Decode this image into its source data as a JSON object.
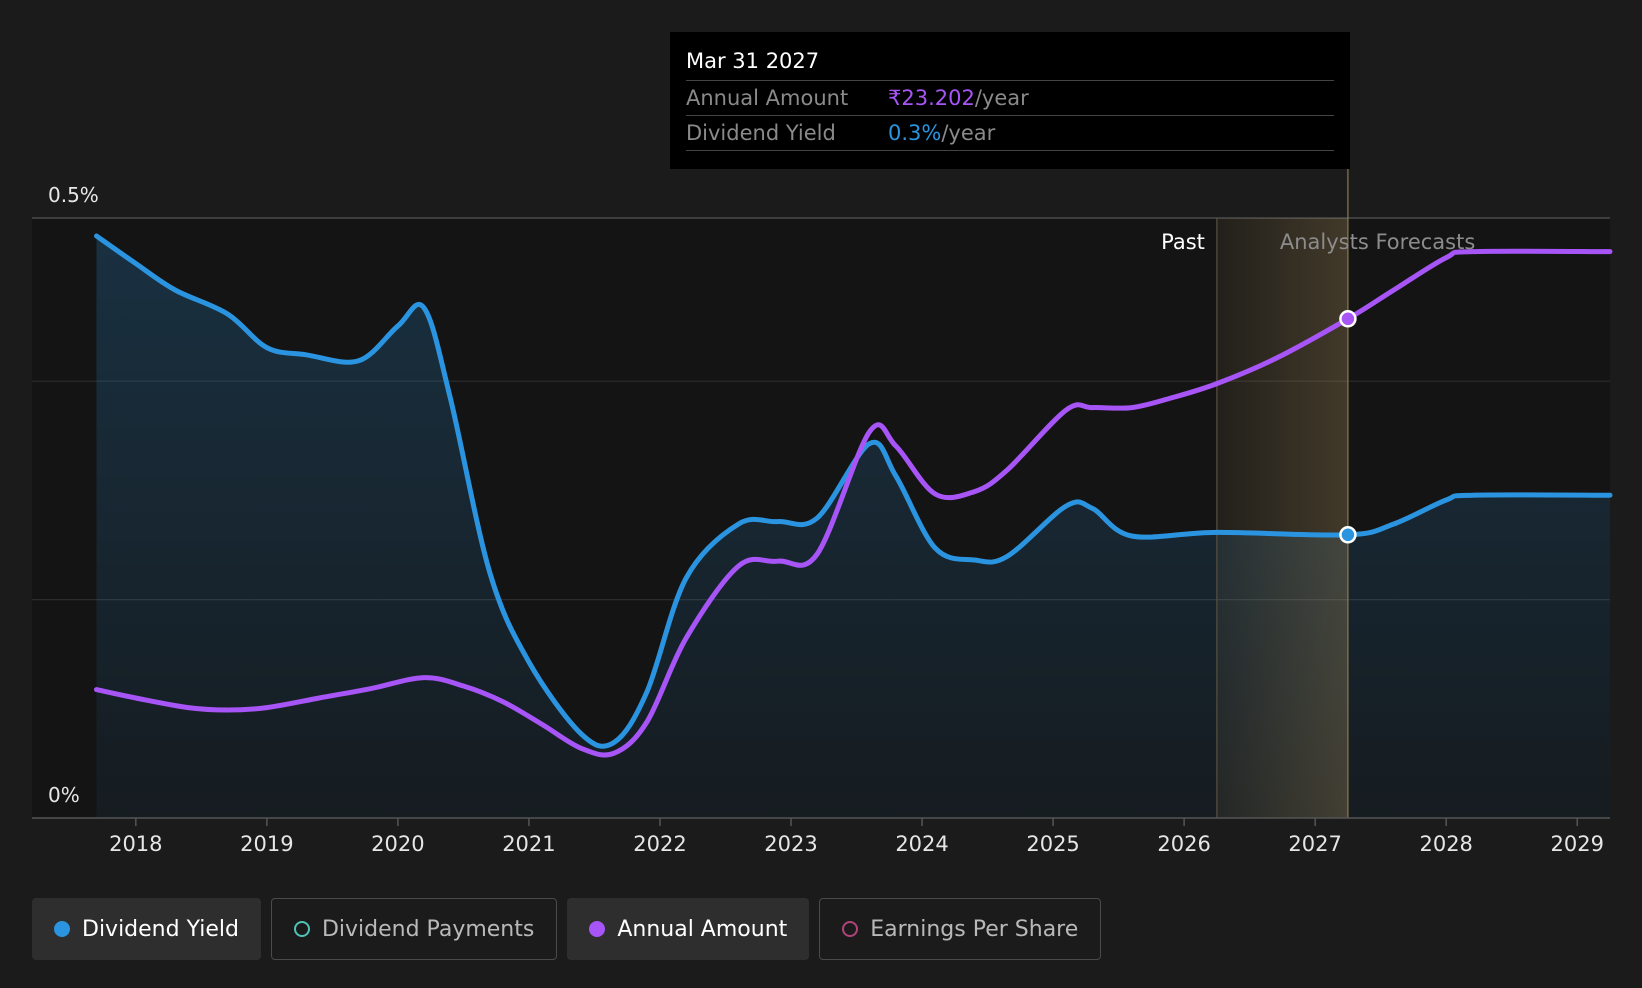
{
  "tooltip": {
    "date": "Mar 31 2027",
    "rows": [
      {
        "label": "Annual Amount",
        "value": "₹23.202",
        "unit": "/year"
      },
      {
        "label": "Dividend Yield",
        "value": "0.3%",
        "unit": "/year"
      }
    ]
  },
  "legend": [
    {
      "label": "Dividend Yield",
      "color": "#2b94e0",
      "active": true
    },
    {
      "label": "Dividend Payments",
      "color": "#4fc3b5",
      "active": false
    },
    {
      "label": "Annual Amount",
      "color": "#a855f7",
      "active": true
    },
    {
      "label": "Earnings Per Share",
      "color": "#b0437a",
      "active": false
    }
  ],
  "chart_data": {
    "type": "line",
    "y_tick_labels": [
      "0.5%",
      "0%"
    ],
    "ylim": [
      0,
      0.5
    ],
    "xlim": [
      2017.7,
      2029.25
    ],
    "x_ticks": [
      2018,
      2019,
      2020,
      2021,
      2022,
      2023,
      2024,
      2025,
      2026,
      2027,
      2028,
      2029
    ],
    "regions": {
      "past_label": "Past",
      "forecast_label": "Analysts Forecasts",
      "past_end": 2026.25,
      "forecast_band_end": 2027.25
    },
    "hover_x": 2027.25,
    "series": [
      {
        "name": "Dividend Yield",
        "color": "#2b94e0",
        "area": true,
        "points": [
          [
            2017.7,
            0.485
          ],
          [
            2018.0,
            0.462
          ],
          [
            2018.3,
            0.44
          ],
          [
            2018.7,
            0.42
          ],
          [
            2019.0,
            0.392
          ],
          [
            2019.3,
            0.386
          ],
          [
            2019.7,
            0.381
          ],
          [
            2020.0,
            0.41
          ],
          [
            2020.2,
            0.425
          ],
          [
            2020.4,
            0.35
          ],
          [
            2020.7,
            0.205
          ],
          [
            2021.0,
            0.13
          ],
          [
            2021.4,
            0.07
          ],
          [
            2021.65,
            0.063
          ],
          [
            2021.9,
            0.105
          ],
          [
            2022.2,
            0.2
          ],
          [
            2022.6,
            0.245
          ],
          [
            2022.9,
            0.247
          ],
          [
            2023.2,
            0.25
          ],
          [
            2023.6,
            0.312
          ],
          [
            2023.8,
            0.285
          ],
          [
            2024.1,
            0.225
          ],
          [
            2024.4,
            0.215
          ],
          [
            2024.65,
            0.218
          ],
          [
            2025.1,
            0.26
          ],
          [
            2025.3,
            0.258
          ],
          [
            2025.6,
            0.235
          ],
          [
            2026.25,
            0.238
          ],
          [
            2027.25,
            0.236
          ],
          [
            2027.6,
            0.245
          ],
          [
            2028.0,
            0.265
          ],
          [
            2028.2,
            0.269
          ],
          [
            2029.25,
            0.269
          ]
        ]
      },
      {
        "name": "Annual Amount",
        "color": "#a855f7",
        "area": false,
        "points": [
          [
            2017.7,
            0.107
          ],
          [
            2018.0,
            0.1
          ],
          [
            2018.4,
            0.092
          ],
          [
            2018.7,
            0.09
          ],
          [
            2019.0,
            0.092
          ],
          [
            2019.4,
            0.1
          ],
          [
            2019.8,
            0.108
          ],
          [
            2020.2,
            0.117
          ],
          [
            2020.5,
            0.11
          ],
          [
            2020.8,
            0.097
          ],
          [
            2021.1,
            0.078
          ],
          [
            2021.4,
            0.058
          ],
          [
            2021.65,
            0.054
          ],
          [
            2021.9,
            0.08
          ],
          [
            2022.2,
            0.15
          ],
          [
            2022.6,
            0.21
          ],
          [
            2022.9,
            0.214
          ],
          [
            2023.2,
            0.22
          ],
          [
            2023.6,
            0.322
          ],
          [
            2023.8,
            0.31
          ],
          [
            2024.1,
            0.27
          ],
          [
            2024.4,
            0.272
          ],
          [
            2024.65,
            0.29
          ],
          [
            2025.1,
            0.34
          ],
          [
            2025.3,
            0.342
          ],
          [
            2025.6,
            0.342
          ],
          [
            2025.9,
            0.35
          ],
          [
            2026.25,
            0.362
          ],
          [
            2026.7,
            0.383
          ],
          [
            2027.25,
            0.416
          ],
          [
            2027.6,
            0.44
          ],
          [
            2028.0,
            0.467
          ],
          [
            2028.2,
            0.472
          ],
          [
            2029.25,
            0.472
          ]
        ]
      }
    ]
  }
}
